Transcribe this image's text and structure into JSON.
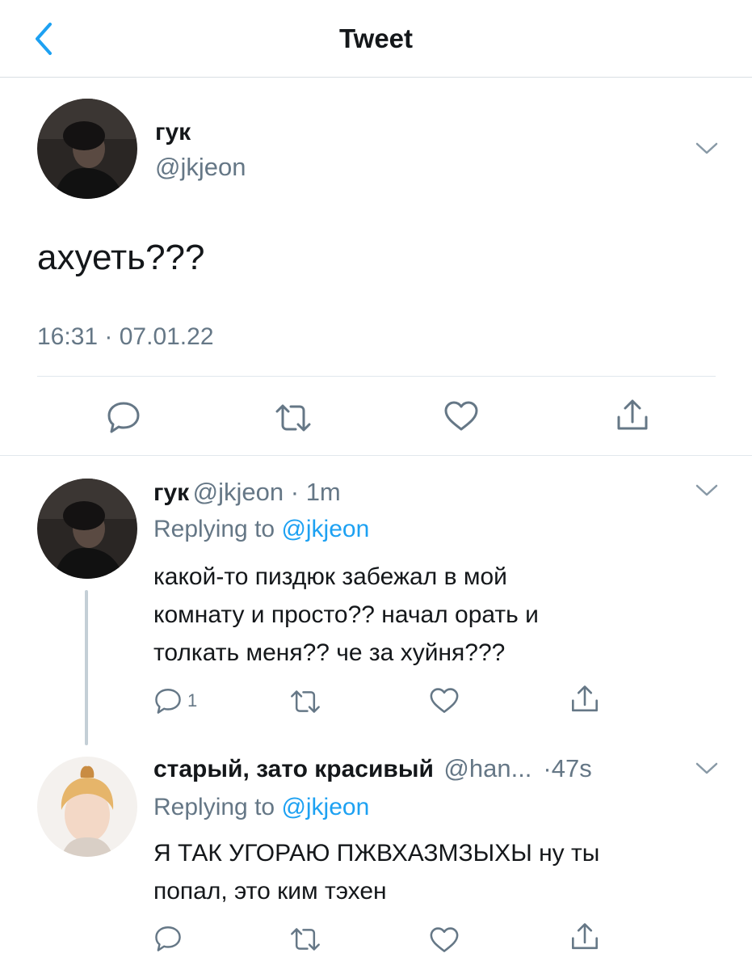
{
  "header": {
    "title": "Tweet",
    "back_icon": "chevron-left-icon",
    "accent": "#1da1f2"
  },
  "main_tweet": {
    "display_name": "гук",
    "handle": "@jkjeon",
    "text": "ахуеть???",
    "timestamp": "16:31 · 07.01.22",
    "actions": [
      "reply-icon",
      "retweet-icon",
      "like-icon",
      "share-icon"
    ]
  },
  "replies": [
    {
      "display_name": "гук",
      "handle": "@jkjeon",
      "time": "1m",
      "replying_label": "Replying to",
      "replying_to": "@jkjeon",
      "text_lines": [
        "какой-то пиздюк забежал в мой",
        "комнату и просто?? начал орать и",
        "толкать меня?? че за хуйня???"
      ],
      "reply_count": "1"
    },
    {
      "display_name": "старый, зато красивый",
      "handle": "@han...",
      "time": "47s",
      "replying_label": "Replying to",
      "replying_to": "@jkjeon",
      "text_lines": [
        "Я ТАК УГОРАЮ ПЖВХАЗМЗЫХЫ ну ты",
        "попал, это ким тэхен"
      ],
      "reply_count": ""
    }
  ],
  "colors": {
    "secondary_text": "#657786",
    "divider": "#e1e8ed",
    "thread_line": "#c4cfd6"
  }
}
